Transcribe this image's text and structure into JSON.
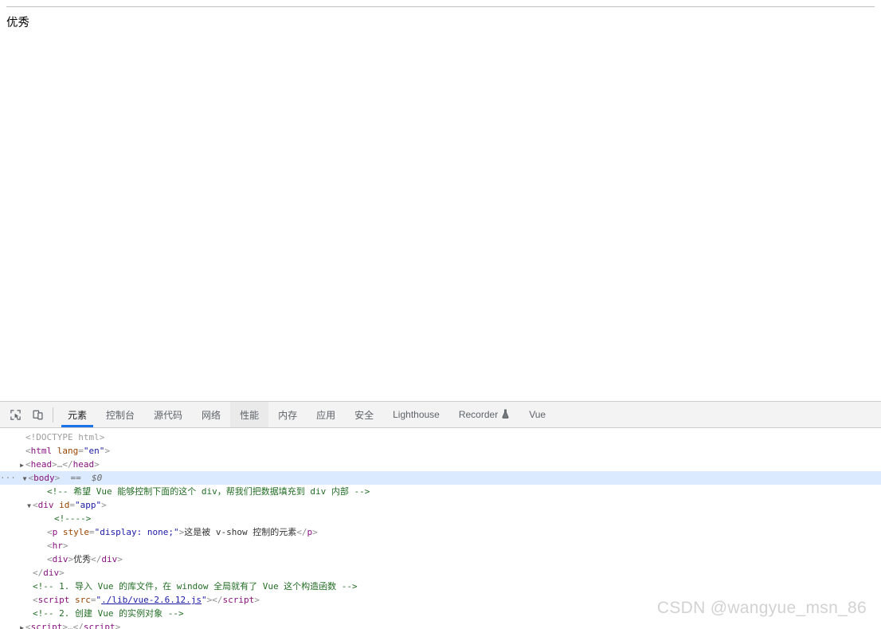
{
  "page": {
    "rendered_text": "优秀"
  },
  "devtools": {
    "toolbar_icons": [
      {
        "name": "inspect-element-icon",
        "title": "检查元素"
      },
      {
        "name": "device-toolbar-icon",
        "title": "切换设备工具栏"
      }
    ],
    "tabs": [
      {
        "label": "元素",
        "state": "selected",
        "cjk": true
      },
      {
        "label": "控制台",
        "state": "normal",
        "cjk": true
      },
      {
        "label": "源代码",
        "state": "normal",
        "cjk": true
      },
      {
        "label": "网络",
        "state": "normal",
        "cjk": true
      },
      {
        "label": "性能",
        "state": "hovered",
        "cjk": true
      },
      {
        "label": "内存",
        "state": "normal",
        "cjk": true
      },
      {
        "label": "应用",
        "state": "normal",
        "cjk": true
      },
      {
        "label": "安全",
        "state": "normal",
        "cjk": true
      },
      {
        "label": "Lighthouse",
        "state": "normal",
        "cjk": false
      },
      {
        "label": "Recorder",
        "state": "normal",
        "cjk": false,
        "icon": "flask-icon"
      },
      {
        "label": "Vue",
        "state": "normal",
        "cjk": false
      }
    ],
    "dom_lines": [
      {
        "id": "doctype",
        "indent": 1,
        "marker": "none",
        "selected": false,
        "parts": [
          {
            "cls": "doctype",
            "text": "<!DOCTYPE html>"
          }
        ]
      },
      {
        "id": "html-open",
        "indent": 1,
        "marker": "none",
        "selected": false,
        "parts": [
          {
            "cls": "punct",
            "text": "<"
          },
          {
            "cls": "tag",
            "text": "html"
          },
          {
            "cls": "punct",
            "text": " "
          },
          {
            "cls": "attr-n",
            "text": "lang"
          },
          {
            "cls": "punct",
            "text": "="
          },
          {
            "cls": "attr-v",
            "text": "\"en\""
          },
          {
            "cls": "punct",
            "text": ">"
          }
        ]
      },
      {
        "id": "head-collapsed",
        "indent": 1,
        "marker": "collapsed",
        "selected": false,
        "parts": [
          {
            "cls": "punct",
            "text": "<"
          },
          {
            "cls": "tag",
            "text": "head"
          },
          {
            "cls": "punct",
            "text": ">"
          },
          {
            "cls": "collapsed-dots",
            "text": "…"
          },
          {
            "cls": "punct",
            "text": "</"
          },
          {
            "cls": "tag",
            "text": "head"
          },
          {
            "cls": "punct",
            "text": ">"
          }
        ]
      },
      {
        "id": "body-open",
        "indent": 0,
        "marker": "expanded",
        "badge": "···",
        "selected": true,
        "parts": [
          {
            "cls": "punct",
            "text": "<"
          },
          {
            "cls": "tag",
            "text": "body"
          },
          {
            "cls": "punct",
            "text": ">"
          },
          {
            "cls": "eq0",
            "text": "  ==  $0"
          }
        ]
      },
      {
        "id": "comment-vue-control",
        "indent": 4,
        "marker": "none",
        "selected": false,
        "parts": [
          {
            "cls": "comment",
            "text": "<!-- 希望 Vue 能够控制下面的这个 div，帮我们把数据填充到 div 内部 -->"
          }
        ]
      },
      {
        "id": "div-app-open",
        "indent": 2,
        "marker": "expanded",
        "selected": false,
        "parts": [
          {
            "cls": "punct",
            "text": "<"
          },
          {
            "cls": "tag",
            "text": "div"
          },
          {
            "cls": "punct",
            "text": " "
          },
          {
            "cls": "attr-n",
            "text": "id"
          },
          {
            "cls": "punct",
            "text": "="
          },
          {
            "cls": "attr-v",
            "text": "\"app\""
          },
          {
            "cls": "punct",
            "text": ">"
          }
        ]
      },
      {
        "id": "empty-comment",
        "indent": 5,
        "marker": "none",
        "selected": false,
        "parts": [
          {
            "cls": "comment",
            "text": "<!---->"
          }
        ]
      },
      {
        "id": "p-vshow",
        "indent": 4,
        "marker": "none",
        "selected": false,
        "parts": [
          {
            "cls": "punct",
            "text": "<"
          },
          {
            "cls": "tag",
            "text": "p"
          },
          {
            "cls": "punct",
            "text": " "
          },
          {
            "cls": "attr-n",
            "text": "style"
          },
          {
            "cls": "punct",
            "text": "="
          },
          {
            "cls": "attr-v",
            "text": "\"display: none;\""
          },
          {
            "cls": "punct",
            "text": ">"
          },
          {
            "cls": "txt",
            "text": "这是被 v-show 控制的元素"
          },
          {
            "cls": "punct",
            "text": "</"
          },
          {
            "cls": "tag",
            "text": "p"
          },
          {
            "cls": "punct",
            "text": ">"
          }
        ]
      },
      {
        "id": "hr",
        "indent": 4,
        "marker": "none",
        "selected": false,
        "parts": [
          {
            "cls": "punct",
            "text": "<"
          },
          {
            "cls": "tag",
            "text": "hr"
          },
          {
            "cls": "punct",
            "text": ">"
          }
        ]
      },
      {
        "id": "div-youxiu",
        "indent": 4,
        "marker": "none",
        "selected": false,
        "parts": [
          {
            "cls": "punct",
            "text": "<"
          },
          {
            "cls": "tag",
            "text": "div"
          },
          {
            "cls": "punct",
            "text": ">"
          },
          {
            "cls": "txt",
            "text": "优秀"
          },
          {
            "cls": "punct",
            "text": "</"
          },
          {
            "cls": "tag",
            "text": "div"
          },
          {
            "cls": "punct",
            "text": ">"
          }
        ]
      },
      {
        "id": "div-app-close",
        "indent": 2,
        "marker": "none",
        "selected": false,
        "parts": [
          {
            "cls": "punct",
            "text": "</"
          },
          {
            "cls": "tag",
            "text": "div"
          },
          {
            "cls": "punct",
            "text": ">"
          }
        ]
      },
      {
        "id": "comment-import-vue",
        "indent": 2,
        "marker": "none",
        "selected": false,
        "parts": [
          {
            "cls": "comment",
            "text": "<!-- 1. 导入 Vue 的库文件，在 window 全局就有了 Vue 这个构造函数 -->"
          }
        ]
      },
      {
        "id": "script-src",
        "indent": 2,
        "marker": "none",
        "selected": false,
        "parts": [
          {
            "cls": "punct",
            "text": "<"
          },
          {
            "cls": "tag",
            "text": "script"
          },
          {
            "cls": "punct",
            "text": " "
          },
          {
            "cls": "attr-n",
            "text": "src"
          },
          {
            "cls": "punct",
            "text": "="
          },
          {
            "cls": "attr-v",
            "text": "\""
          },
          {
            "cls": "attr-v link",
            "text": "./lib/vue-2.6.12.js"
          },
          {
            "cls": "attr-v",
            "text": "\""
          },
          {
            "cls": "punct",
            "text": ">"
          },
          {
            "cls": "punct",
            "text": "</"
          },
          {
            "cls": "tag",
            "text": "script"
          },
          {
            "cls": "punct",
            "text": ">"
          }
        ]
      },
      {
        "id": "comment-create-instance",
        "indent": 2,
        "marker": "none",
        "selected": false,
        "parts": [
          {
            "cls": "comment",
            "text": "<!-- 2. 创建 Vue 的实例对象 -->"
          }
        ]
      },
      {
        "id": "script-collapsed",
        "indent": 1,
        "marker": "collapsed",
        "selected": false,
        "parts": [
          {
            "cls": "punct",
            "text": "<"
          },
          {
            "cls": "tag",
            "text": "script"
          },
          {
            "cls": "punct",
            "text": ">"
          },
          {
            "cls": "collapsed-dots",
            "text": "…"
          },
          {
            "cls": "punct",
            "text": "</"
          },
          {
            "cls": "tag",
            "text": "script"
          },
          {
            "cls": "punct",
            "text": ">"
          }
        ]
      }
    ]
  },
  "watermark": {
    "text": "CSDN @wangyue_msn_86"
  },
  "colors": {
    "accent": "#1a73e8",
    "tabbar_bg": "#f3f3f3",
    "selected_row": "#dbeafe",
    "tag": "#881280",
    "attr_name": "#994500",
    "attr_value": "#1a1aa6",
    "comment": "#236e25",
    "watermark": "#d2d2d2"
  }
}
